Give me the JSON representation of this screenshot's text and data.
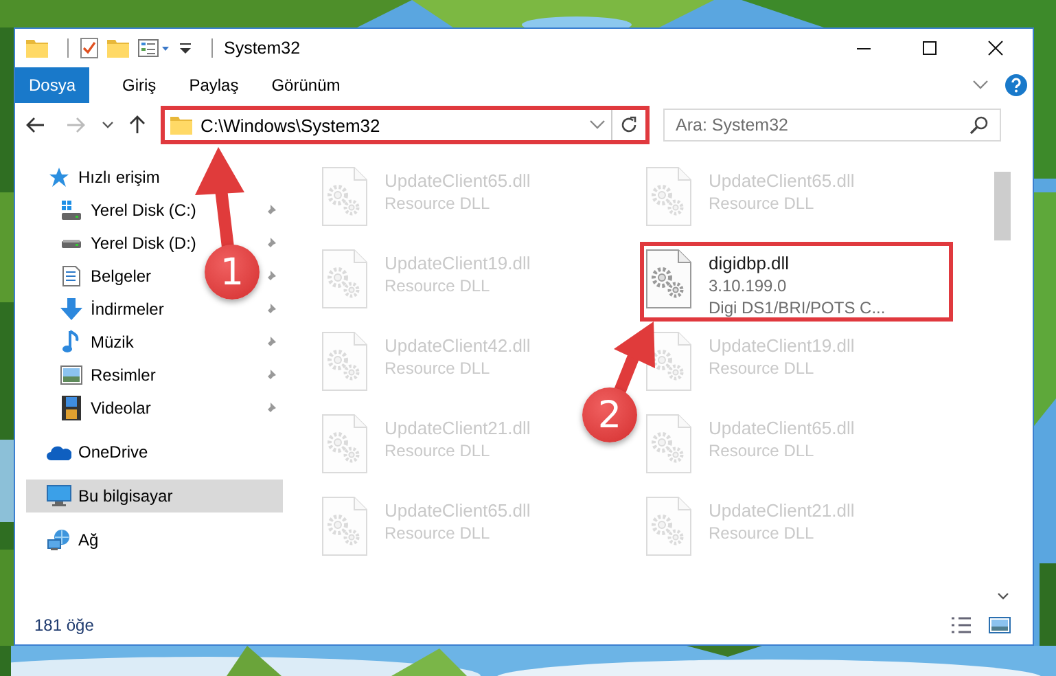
{
  "window": {
    "title": "System32"
  },
  "ribbon_tabs": [
    {
      "label": "Dosya",
      "selected": true
    },
    {
      "label": "Giriş",
      "selected": false
    },
    {
      "label": "Paylaş",
      "selected": false
    },
    {
      "label": "Görünüm",
      "selected": false
    }
  ],
  "address": {
    "path": "C:\\Windows\\System32",
    "highlighted": true
  },
  "search": {
    "placeholder": "Ara: System32"
  },
  "nav": [
    {
      "label": "Hızlı erişim",
      "selected": false,
      "children": [
        {
          "label": "Yerel Disk (C:)",
          "pinned": true,
          "selected": false
        },
        {
          "label": "Yerel Disk (D:)",
          "pinned": true,
          "selected": false
        },
        {
          "label": "Belgeler",
          "pinned": true,
          "selected": false
        },
        {
          "label": "İndirmeler",
          "pinned": true,
          "selected": false
        },
        {
          "label": "Müzik",
          "pinned": true,
          "selected": false
        },
        {
          "label": "Resimler",
          "pinned": true,
          "selected": false
        },
        {
          "label": "Videolar",
          "pinned": true,
          "selected": false
        }
      ]
    },
    {
      "label": "OneDrive",
      "selected": false
    },
    {
      "label": "Bu bilgisayar",
      "selected": true
    },
    {
      "label": "Ağ",
      "selected": false
    }
  ],
  "files": [
    {
      "name": "UpdateClient65.dll",
      "lines": [
        "Resource DLL"
      ],
      "blurred": true,
      "highlighted": false
    },
    {
      "name": "UpdateClient65.dll",
      "lines": [
        "Resource DLL"
      ],
      "blurred": true,
      "highlighted": false
    },
    {
      "name": "UpdateClient19.dll",
      "lines": [
        "Resource DLL"
      ],
      "blurred": true,
      "highlighted": false
    },
    {
      "name": "digidbp.dll",
      "lines": [
        "3.10.199.0",
        "Digi DS1/BRI/POTS C..."
      ],
      "blurred": false,
      "highlighted": true
    },
    {
      "name": "UpdateClient42.dll",
      "lines": [
        "Resource DLL"
      ],
      "blurred": true,
      "highlighted": false
    },
    {
      "name": "UpdateClient19.dll",
      "lines": [
        "Resource DLL"
      ],
      "blurred": true,
      "highlighted": false
    },
    {
      "name": "UpdateClient21.dll",
      "lines": [
        "Resource DLL"
      ],
      "blurred": true,
      "highlighted": false
    },
    {
      "name": "UpdateClient65.dll",
      "lines": [
        "Resource DLL"
      ],
      "blurred": true,
      "highlighted": false
    },
    {
      "name": "UpdateClient65.dll",
      "lines": [
        "Resource DLL"
      ],
      "blurred": true,
      "highlighted": false
    },
    {
      "name": "UpdateClient21.dll",
      "lines": [
        "Resource DLL"
      ],
      "blurred": true,
      "highlighted": false
    }
  ],
  "annotations": [
    {
      "label": "1"
    },
    {
      "label": "2"
    }
  ],
  "status_bar": {
    "item_count": "181 öğe"
  }
}
